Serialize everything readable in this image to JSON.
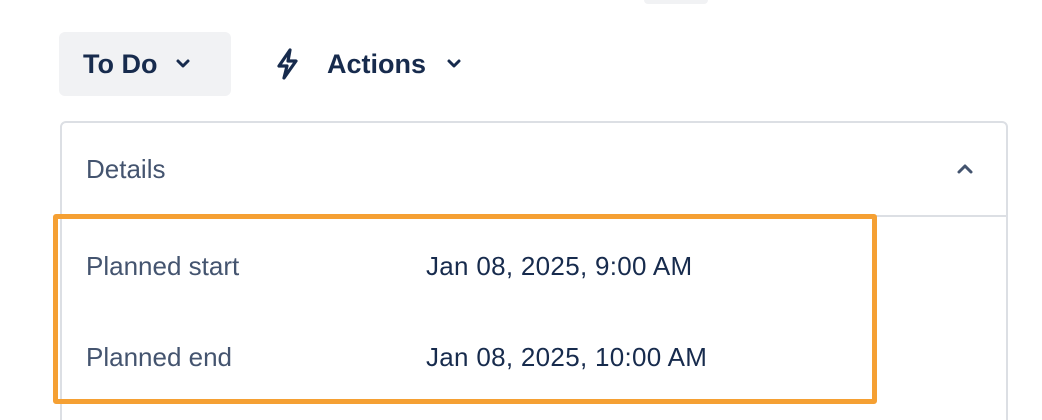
{
  "toolbar": {
    "status_label": "To Do",
    "actions_label": "Actions"
  },
  "details": {
    "title": "Details",
    "fields": [
      {
        "label": "Planned start",
        "value": "Jan 08, 2025, 9:00 AM"
      },
      {
        "label": "Planned end",
        "value": "Jan 08, 2025, 10:00 AM"
      }
    ]
  },
  "colors": {
    "highlight": "#f5a033",
    "button_bg": "#f1f2f4",
    "text_primary": "#172b4d",
    "text_secondary": "#44546f"
  }
}
